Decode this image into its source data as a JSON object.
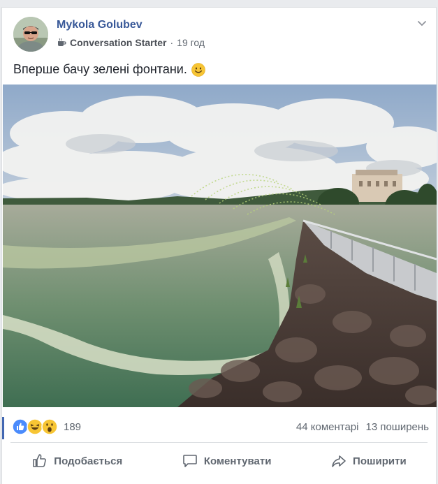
{
  "post": {
    "author": "Mykola Golubev",
    "badge": "Conversation Starter",
    "separator": "·",
    "time": "19 год",
    "text": "Вперше бачу зелені фонтани.",
    "emoji_icon": "smile-emoji-icon",
    "badge_icon": "coffee-cup-icon",
    "menu_icon": "chevron-down-icon"
  },
  "stats": {
    "reactions": [
      "like",
      "haha",
      "wow"
    ],
    "reaction_count": "189",
    "comments": "44 коментарі",
    "shares": "13 поширень"
  },
  "actions": {
    "like": "Подобається",
    "comment": "Коментувати",
    "share": "Поширити"
  },
  "colors": {
    "author": "#385898",
    "accent": "#4267b2",
    "secondary_text": "#606770",
    "background": "#e9ebee"
  }
}
